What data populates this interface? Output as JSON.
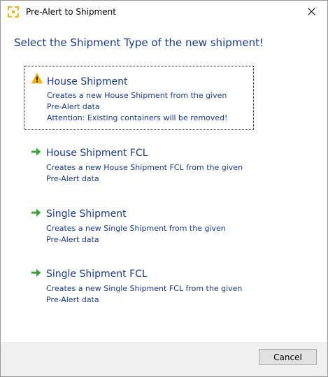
{
  "window": {
    "title": "Pre-Alert to Shipment"
  },
  "heading": "Select the Shipment Type of the new shipment!",
  "options": [
    {
      "icon": "warning-icon",
      "title": "House Shipment",
      "lines": [
        "Creates a new House Shipment from the given",
        "Pre-Alert data",
        "Attention: Existing containers will be removed!"
      ],
      "selected": true
    },
    {
      "icon": "arrow-right-icon",
      "title": "House Shipment FCL",
      "lines": [
        "Creates a new House Shipment FCL from the given",
        "Pre-Alert data"
      ],
      "selected": false
    },
    {
      "icon": "arrow-right-icon",
      "title": "Single Shipment",
      "lines": [
        "Creates a new Single Shipment from the given",
        "Pre-Alert data"
      ],
      "selected": false
    },
    {
      "icon": "arrow-right-icon",
      "title": "Single Shipment FCL",
      "lines": [
        "Creates a new Single Shipment FCL from the given",
        "Pre-Alert data"
      ],
      "selected": false
    }
  ],
  "footer": {
    "cancel_label": "Cancel"
  },
  "colors": {
    "text_blue": "#1a3a8c",
    "warning": "#f5b400",
    "arrow": "#3aa53a",
    "footer_bg": "#f0f0f0"
  }
}
